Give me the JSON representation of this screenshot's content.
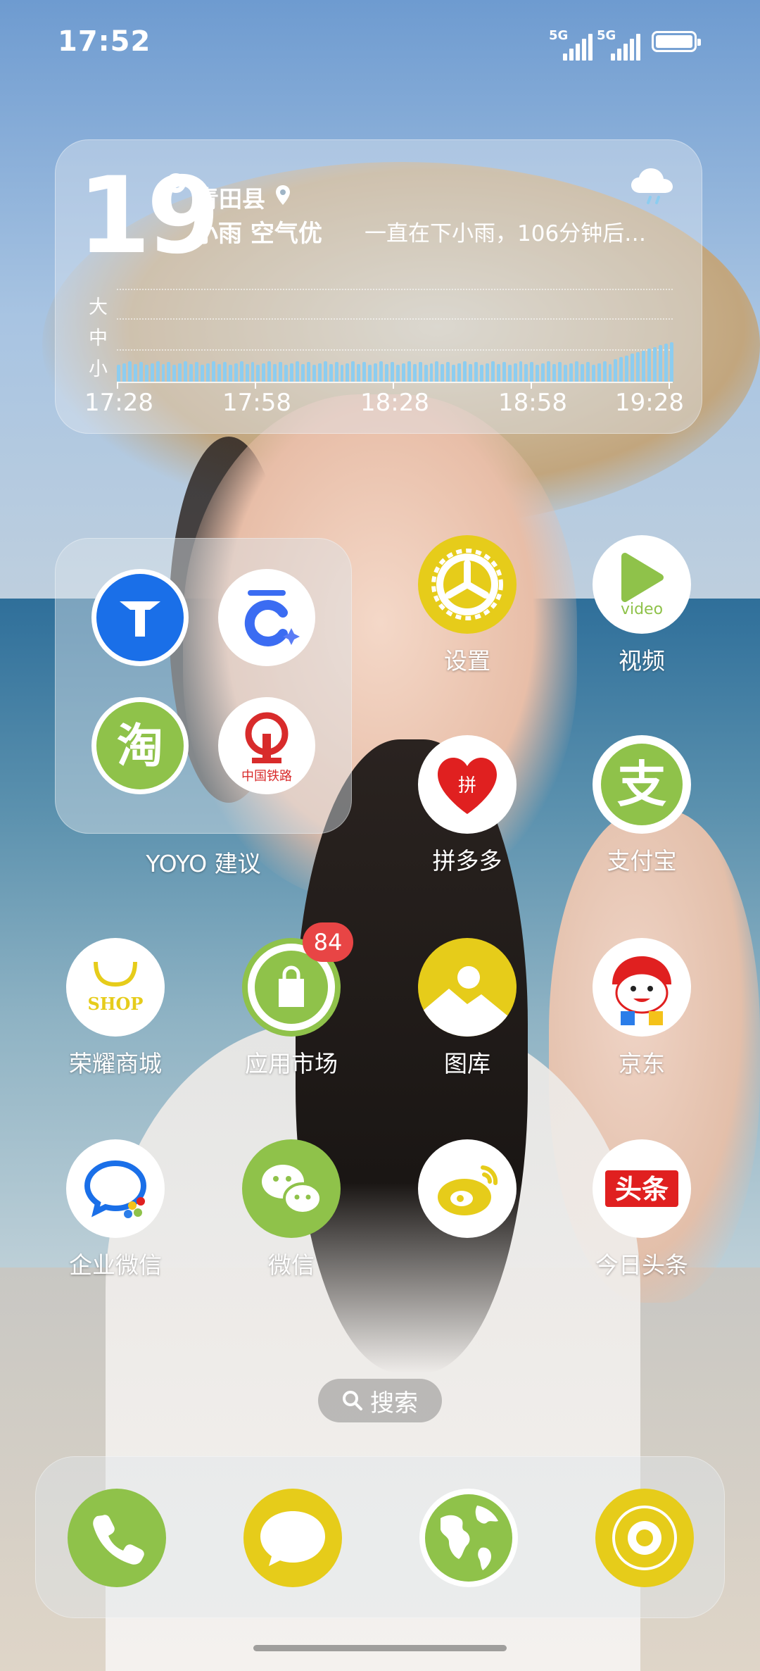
{
  "status_bar": {
    "time": "17:52",
    "sim1": "5G",
    "sim2": "5G",
    "battery_level": 1.0
  },
  "weather": {
    "temperature": "19",
    "location": "青田县",
    "condition": "小雨 空气优",
    "forecast": "一直在下小雨，106分钟后…",
    "intensity_labels": [
      "大",
      "中",
      "小"
    ],
    "time_labels": [
      "17:28",
      "17:58",
      "18:28",
      "18:58",
      "19:28"
    ],
    "icon": "cloud-rain-icon",
    "bar_color": "#8ccdf0"
  },
  "folder": {
    "label": "YOYO 建议",
    "items": [
      {
        "name": "gaode-maps",
        "icon": "navigation-arrow-icon",
        "color": "#1a6fe8"
      },
      {
        "name": "ctrip",
        "icon": "ctrip-c-icon",
        "color": "#3b6cf2"
      },
      {
        "name": "taobao",
        "icon": "taobao-icon",
        "text": "淘",
        "color": "#8fc24a"
      },
      {
        "name": "railway-12306",
        "icon": "railway-icon",
        "text": "中国铁路",
        "color": "#d82b2b"
      }
    ]
  },
  "apps": [
    {
      "label": "设置",
      "icon": "gear-icon",
      "color": "#e6cc1a"
    },
    {
      "label": "视频",
      "icon": "video-play-icon",
      "text": "video",
      "color": "#8fc24a"
    },
    {
      "label": "拼多多",
      "icon": "pinduoduo-heart-icon",
      "text": "拼",
      "color": "#e02020"
    },
    {
      "label": "支付宝",
      "icon": "alipay-icon",
      "text": "支",
      "color": "#8fc24a"
    },
    {
      "label": "荣耀商城",
      "icon": "shop-bag-icon",
      "text": "SHOP",
      "color": "#e6cc1a"
    },
    {
      "label": "应用市场",
      "icon": "app-market-bag-icon",
      "color": "#8fc24a",
      "badge": "84"
    },
    {
      "label": "图库",
      "icon": "gallery-icon",
      "color": "#e6cc1a"
    },
    {
      "label": "京东",
      "icon": "jd-mascot-icon",
      "color": "#e02020"
    },
    {
      "label": "企业微信",
      "icon": "wecom-icon",
      "color": "#1a6fe8"
    },
    {
      "label": "微信",
      "icon": "wechat-icon",
      "color": "#8fc24a"
    },
    {
      "label": "",
      "icon": "weibo-icon",
      "color": "#e6cc1a"
    },
    {
      "label": "今日头条",
      "icon": "toutiao-icon",
      "text": "头条",
      "color": "#e02020"
    }
  ],
  "search": {
    "label": "搜索",
    "icon": "search-icon"
  },
  "dock": [
    {
      "name": "phone",
      "icon": "phone-icon",
      "color": "#8fc24a"
    },
    {
      "name": "messages",
      "icon": "message-bubble-icon",
      "color": "#e6cc1a"
    },
    {
      "name": "browser",
      "icon": "globe-icon",
      "color": "#8fc24a"
    },
    {
      "name": "music",
      "icon": "music-disc-icon",
      "color": "#e6cc1a"
    }
  ]
}
